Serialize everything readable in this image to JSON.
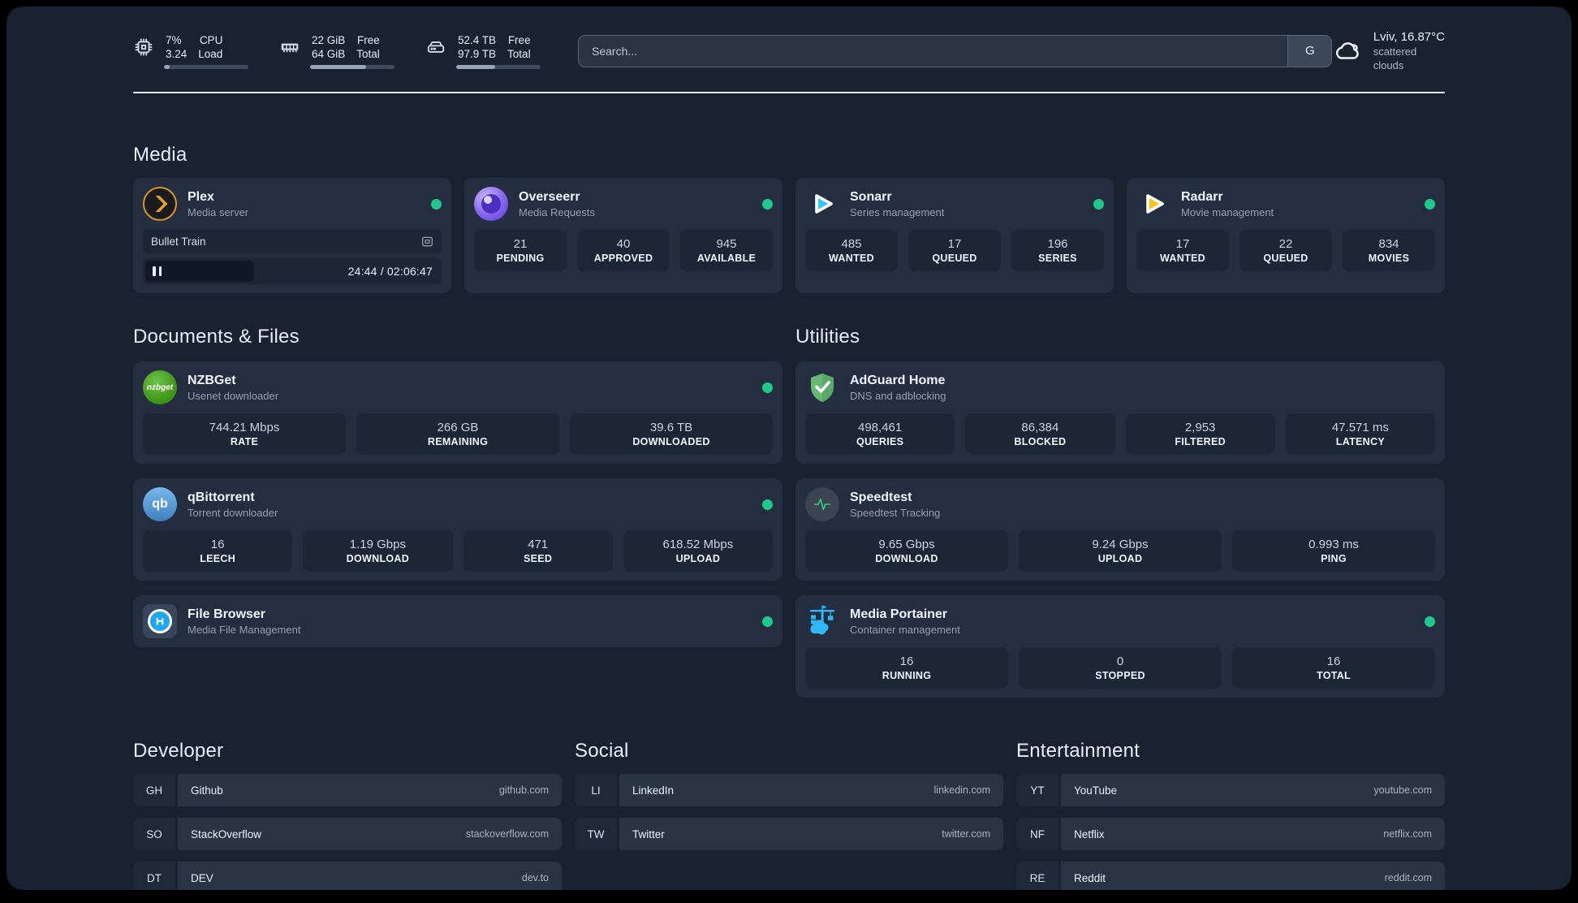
{
  "header": {
    "resources": [
      {
        "icon": "cpu-icon",
        "line1": "7%",
        "line2": "3.24",
        "label1": "CPU",
        "label2": "Load",
        "progress": 7
      },
      {
        "icon": "memory-icon",
        "line1": "22 GiB",
        "line2": "64 GiB",
        "label1": "Free",
        "label2": "Total",
        "progress": 66
      },
      {
        "icon": "disk-icon",
        "line1": "52.4 TB",
        "line2": "97.9 TB",
        "label1": "Free",
        "label2": "Total",
        "progress": 46
      }
    ],
    "search": {
      "placeholder": "Search...",
      "provider_button": "G"
    },
    "weather": {
      "location": "Lviv, 16.87°C",
      "condition": "scattered clouds"
    }
  },
  "media": {
    "title": "Media",
    "plex": {
      "name": "Plex",
      "description": "Media server",
      "status": "online",
      "player": {
        "title": "Bullet Train",
        "time": "24:44 / 02:06:47"
      }
    },
    "overseerr": {
      "name": "Overseerr",
      "description": "Media Requests",
      "status": "online",
      "stats": [
        {
          "value": "21",
          "label": "PENDING"
        },
        {
          "value": "40",
          "label": "APPROVED"
        },
        {
          "value": "945",
          "label": "AVAILABLE"
        }
      ]
    },
    "sonarr": {
      "name": "Sonarr",
      "description": "Series management",
      "status": "online",
      "stats": [
        {
          "value": "485",
          "label": "WANTED"
        },
        {
          "value": "17",
          "label": "QUEUED"
        },
        {
          "value": "196",
          "label": "SERIES"
        }
      ]
    },
    "radarr": {
      "name": "Radarr",
      "description": "Movie management",
      "status": "online",
      "stats": [
        {
          "value": "17",
          "label": "WANTED"
        },
        {
          "value": "22",
          "label": "QUEUED"
        },
        {
          "value": "834",
          "label": "MOVIES"
        }
      ]
    }
  },
  "documents": {
    "title": "Documents & Files",
    "nzbget": {
      "name": "NZBGet",
      "description": "Usenet downloader",
      "status": "online",
      "stats": [
        {
          "value": "744.21 Mbps",
          "label": "RATE"
        },
        {
          "value": "266 GB",
          "label": "REMAINING"
        },
        {
          "value": "39.6 TB",
          "label": "DOWNLOADED"
        }
      ]
    },
    "qbittorrent": {
      "name": "qBittorrent",
      "description": "Torrent downloader",
      "status": "online",
      "stats": [
        {
          "value": "16",
          "label": "LEECH"
        },
        {
          "value": "1.19 Gbps",
          "label": "DOWNLOAD"
        },
        {
          "value": "471",
          "label": "SEED"
        },
        {
          "value": "618.52 Mbps",
          "label": "UPLOAD"
        }
      ]
    },
    "filebrowser": {
      "name": "File Browser",
      "description": "Media File Management",
      "status": "online"
    }
  },
  "utilities": {
    "title": "Utilities",
    "adguard": {
      "name": "AdGuard Home",
      "description": "DNS and adblocking",
      "stats": [
        {
          "value": "498,461",
          "label": "QUERIES"
        },
        {
          "value": "86,384",
          "label": "BLOCKED"
        },
        {
          "value": "2,953",
          "label": "FILTERED"
        },
        {
          "value": "47.571 ms",
          "label": "LATENCY"
        }
      ]
    },
    "speedtest": {
      "name": "Speedtest",
      "description": "Speedtest Tracking",
      "stats": [
        {
          "value": "9.65 Gbps",
          "label": "DOWNLOAD"
        },
        {
          "value": "9.24 Gbps",
          "label": "UPLOAD"
        },
        {
          "value": "0.993 ms",
          "label": "PING"
        }
      ]
    },
    "portainer": {
      "name": "Media Portainer",
      "description": "Container management",
      "status": "online",
      "stats": [
        {
          "value": "16",
          "label": "RUNNING"
        },
        {
          "value": "0",
          "label": "STOPPED"
        },
        {
          "value": "16",
          "label": "TOTAL"
        }
      ]
    }
  },
  "bookmarks": [
    {
      "title": "Developer",
      "links": [
        {
          "abbr": "GH",
          "name": "Github",
          "url": "github.com"
        },
        {
          "abbr": "SO",
          "name": "StackOverflow",
          "url": "stackoverflow.com"
        },
        {
          "abbr": "DT",
          "name": "DEV",
          "url": "dev.to"
        }
      ]
    },
    {
      "title": "Social",
      "links": [
        {
          "abbr": "LI",
          "name": "LinkedIn",
          "url": "linkedin.com"
        },
        {
          "abbr": "TW",
          "name": "Twitter",
          "url": "twitter.com"
        }
      ]
    },
    {
      "title": "Entertainment",
      "links": [
        {
          "abbr": "YT",
          "name": "YouTube",
          "url": "youtube.com"
        },
        {
          "abbr": "NF",
          "name": "Netflix",
          "url": "netflix.com"
        },
        {
          "abbr": "RE",
          "name": "Reddit",
          "url": "reddit.com"
        }
      ]
    }
  ],
  "colors": {
    "status_online": "#1fc98c",
    "plex_accent": "#e9a02c",
    "sonarr_accent": "#37c6f4",
    "radarr_accent": "#fbc11b",
    "adguard_accent": "#67b874",
    "portainer_accent": "#2fb8f5",
    "speedtest_accent": "#35d07f"
  }
}
